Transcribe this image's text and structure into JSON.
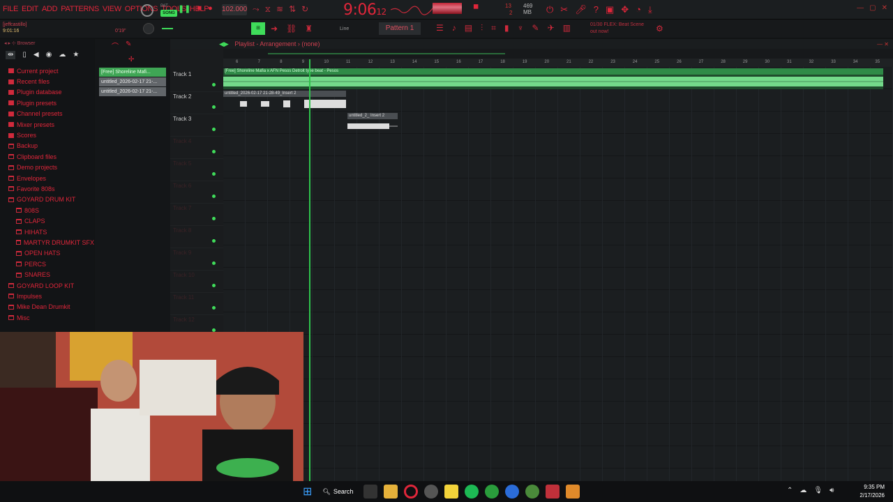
{
  "menu": [
    "FILE",
    "EDIT",
    "ADD",
    "PATTERNS",
    "VIEW",
    "OPTIONS",
    "TOOLS",
    "HELP"
  ],
  "mode": {
    "pat": "PAT",
    "song": "SONG"
  },
  "tempo": "102.000",
  "clock": {
    "main": "9:06",
    "sub": "12"
  },
  "cpu": {
    "v1": "13",
    "v2": "2",
    "mem": "469 MB"
  },
  "user": {
    "name": "[jeffcastillo]",
    "time": "9:01:16"
  },
  "small_time": "0'19\"",
  "snap_label": "Line",
  "pattern": "Pattern 1",
  "news": {
    "line1": "01/30 FLEX: Beat Scene",
    "line2": "out now!"
  },
  "browser": {
    "title": "Browser",
    "items": [
      {
        "label": "Current project",
        "level": 0,
        "type": "fill"
      },
      {
        "label": "Recent files",
        "level": 0,
        "type": "fill"
      },
      {
        "label": "Plugin database",
        "level": 0,
        "type": "fill"
      },
      {
        "label": "Plugin presets",
        "level": 0,
        "type": "fill"
      },
      {
        "label": "Channel presets",
        "level": 0,
        "type": "fill"
      },
      {
        "label": "Mixer presets",
        "level": 0,
        "type": "fill"
      },
      {
        "label": "Scores",
        "level": 0,
        "type": "fill"
      },
      {
        "label": "Backup",
        "level": 0,
        "type": "folder"
      },
      {
        "label": "Clipboard files",
        "level": 0,
        "type": "folder"
      },
      {
        "label": "Demo projects",
        "level": 0,
        "type": "folder"
      },
      {
        "label": "Envelopes",
        "level": 0,
        "type": "folder"
      },
      {
        "label": "Favorite 808s",
        "level": 0,
        "type": "folder"
      },
      {
        "label": "GOYARD DRUM KIT",
        "level": 0,
        "type": "folder"
      },
      {
        "label": "808S",
        "level": 1,
        "type": "folder"
      },
      {
        "label": "CLAPS",
        "level": 1,
        "type": "folder"
      },
      {
        "label": "HIHATS",
        "level": 1,
        "type": "folder"
      },
      {
        "label": "MARTYR DRUMKIT SFX",
        "level": 1,
        "type": "folder"
      },
      {
        "label": "OPEN HATS",
        "level": 1,
        "type": "folder"
      },
      {
        "label": "PERCS",
        "level": 1,
        "type": "folder"
      },
      {
        "label": "SNARES",
        "level": 1,
        "type": "folder"
      },
      {
        "label": "GOYARD LOOP KIT",
        "level": 0,
        "type": "folder"
      },
      {
        "label": "Impulses",
        "level": 0,
        "type": "folder"
      },
      {
        "label": "Mike Dean Drumkit",
        "level": 0,
        "type": "folder"
      },
      {
        "label": "Misc",
        "level": 0,
        "type": "folder"
      }
    ]
  },
  "picker": [
    {
      "label": "[Free] Shoreline Mafi...",
      "active": true
    },
    {
      "label": "untitled_2026-02-17 21-...",
      "active": false
    },
    {
      "label": "untitled_2026-02-17 21-...",
      "active": false
    }
  ],
  "playlist": {
    "title": "Playlist - Arrangement",
    "pattern_sel": "(none)",
    "tracks": [
      "Track 1",
      "Track 2",
      "Track 3",
      "Track 4",
      "Track 5",
      "Track 6",
      "Track 7",
      "Track 8",
      "Track 9",
      "Track 10",
      "Track 11",
      "Track 12"
    ],
    "bars": [
      "6",
      "7",
      "8",
      "9",
      "10",
      "11",
      "12",
      "13",
      "14",
      "15",
      "16",
      "17",
      "18",
      "19",
      "20",
      "21",
      "22",
      "23",
      "24",
      "25",
      "26",
      "27",
      "28",
      "29",
      "30",
      "31",
      "32",
      "33",
      "34",
      "35"
    ],
    "clips": [
      {
        "label": "[Free] Shoreline Mafia x AFN Pesos Detroit type beat - Pesos"
      },
      {
        "label": "untitled_2026-02-17 21-28-49_Insert 2"
      },
      {
        "label": "untitled_2_ Insert 2"
      }
    ]
  },
  "taskbar": {
    "search": "Search",
    "time": "9:35 PM",
    "date": "2/17/2026"
  },
  "colors": {
    "accent": "#e0263a",
    "green": "#3fdc5a",
    "bg": "#111314"
  }
}
